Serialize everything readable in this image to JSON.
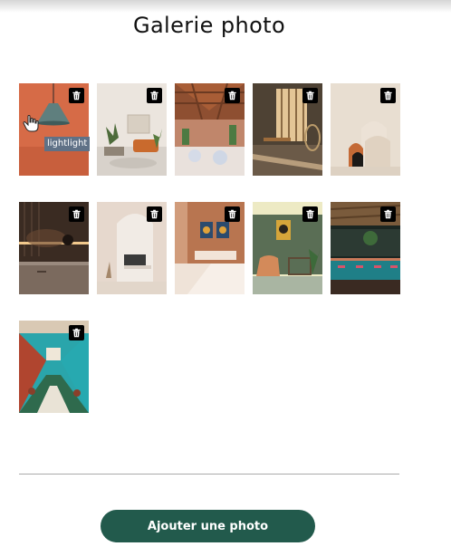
{
  "page": {
    "title": "Galerie photo"
  },
  "gallery": {
    "photos": [
      {
        "name": "photo-pendant-lamp",
        "bg": "#d66b47",
        "delete_icon": "trash-icon"
      },
      {
        "name": "photo-living-room",
        "bg": "#e9e3dc",
        "delete_icon": "trash-icon"
      },
      {
        "name": "photo-wooden-atrium",
        "bg": "#8a4a2e",
        "delete_icon": "trash-icon"
      },
      {
        "name": "photo-desk-window",
        "bg": "#5b4b3a",
        "delete_icon": "trash-icon"
      },
      {
        "name": "photo-arches",
        "bg": "#e6dbcc",
        "delete_icon": "trash-icon"
      },
      {
        "name": "photo-dark-kitchen",
        "bg": "#3d2e25",
        "delete_icon": "trash-icon"
      },
      {
        "name": "photo-white-arch",
        "bg": "#e8dcd2",
        "delete_icon": "trash-icon"
      },
      {
        "name": "photo-terracotta-room",
        "bg": "#b6724b",
        "delete_icon": "trash-icon"
      },
      {
        "name": "photo-green-lounge",
        "bg": "#5e7259",
        "delete_icon": "trash-icon"
      },
      {
        "name": "photo-teal-bar",
        "bg": "#1f6f76",
        "delete_icon": "trash-icon"
      },
      {
        "name": "photo-restaurant-hall",
        "bg": "#2aa1a6",
        "delete_icon": "trash-icon"
      }
    ]
  },
  "tooltip": {
    "text": "lightlight"
  },
  "actions": {
    "add_photo_label": "Ajouter une photo"
  },
  "colors": {
    "accent": "#225a4c",
    "tooltip_bg": "#5f7186",
    "divider": "#a9a9a9"
  }
}
